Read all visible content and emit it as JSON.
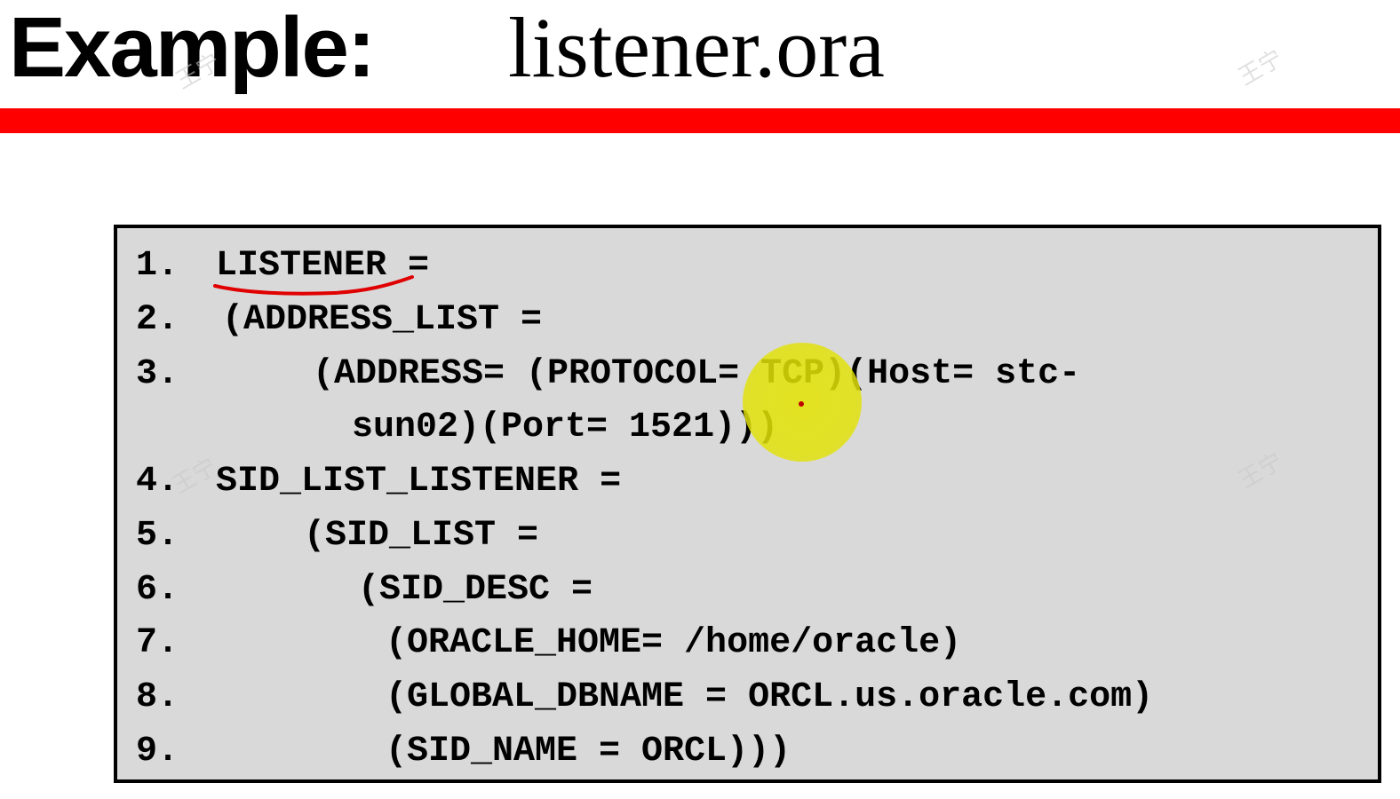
{
  "header": {
    "title_bold": "Example:",
    "title_rest": "listener.ora"
  },
  "code": {
    "lines": [
      {
        "num": "1.",
        "text": "LISTENER ="
      },
      {
        "num": "2.",
        "text": "(ADDRESS_LIST ="
      },
      {
        "num": "3.",
        "text": "(ADDRESS= (PROTOCOL= TCP)(Host= stc-",
        "continuation": "sun02)(Port= 1521)))"
      },
      {
        "num": "4.",
        "text": "SID_LIST_LISTENER ="
      },
      {
        "num": "5.",
        "text": "(SID_LIST ="
      },
      {
        "num": "6.",
        "text": "(SID_DESC ="
      },
      {
        "num": "7.",
        "text": "(ORACLE_HOME= /home/oracle)"
      },
      {
        "num": "8.",
        "text": "(GLOBAL_DBNAME = ORCL.us.oracle.com)"
      },
      {
        "num": "9.",
        "text": "(SID_NAME = ORCL)))"
      }
    ]
  },
  "watermark_text": "王宁",
  "colors": {
    "accent_bar": "#ff0000",
    "code_background": "#d9d9d9",
    "pointer_highlight": "#e4e400",
    "annotation_ink": "#e00000"
  }
}
